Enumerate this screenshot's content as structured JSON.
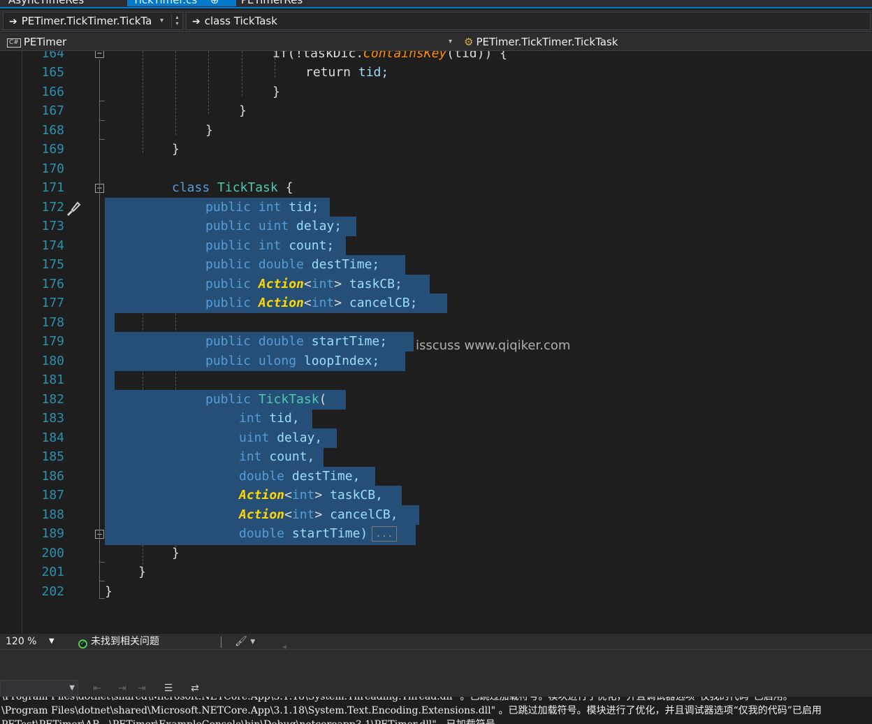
{
  "tabs": {
    "items": [
      "AsyncTimeRes",
      "TickTimer.cs",
      "PETimerRes"
    ],
    "active_pin": "⊕",
    "active_close": "✕"
  },
  "nav1": {
    "scope_combo": "PETimer.TickTimer.TickTa",
    "member_combo": "class TickTask",
    "arrow_icon": "➔"
  },
  "nav2": {
    "project": "PETimer",
    "type": "PETimer.TickTimer.TickTask"
  },
  "editor": {
    "line_numbers": [
      "164",
      "165",
      "166",
      "167",
      "168",
      "169",
      "170",
      "171",
      "172",
      "173",
      "174",
      "175",
      "176",
      "177",
      "178",
      "179",
      "180",
      "181",
      "182",
      "183",
      "184",
      "185",
      "186",
      "187",
      "188",
      "189",
      "200",
      "201",
      "202"
    ],
    "code": {
      "l164a": "if(!taskDic.",
      "l164b": "ContainsKey",
      "l164c": "(tid)) {",
      "l165_kw": "return",
      "l165_id": " tid;",
      "brace": "}",
      "l171_kw": "class ",
      "l171_ty": "TickTask",
      "l171_pl": " {",
      "kw_public": "public ",
      "kw_int": "int",
      "kw_uint": "uint",
      "kw_double": "double",
      "kw_ulong": "ulong",
      "type_action": "Action",
      "generic_int_open": "<",
      "generic_int": "int",
      "generic_int_close": ">",
      "f_tid": " tid;",
      "f_delay": " delay;",
      "f_count": " count;",
      "f_destTime": " destTime;",
      "f_taskCB": " taskCB;",
      "f_cancelCB": " cancelCB;",
      "f_startTime": " startTime;",
      "f_loopIndex": " loopIndex;",
      "ctor_name": "TickTask",
      "ctor_open": "(",
      "p_tid": " tid,",
      "p_delay": " delay,",
      "p_count": " count,",
      "p_destTime": " destTime,",
      "p_taskCB": " taskCB,",
      "p_cancelCB": " cancelCB,",
      "p_startTime": " startTime)",
      "collapsed_marker": "..."
    },
    "watermark": "isscuss www.qiqiker.com"
  },
  "status": {
    "zoom": "120 %",
    "issues": "未找到相关问题"
  },
  "output": {
    "line1": "\\Program Files\\dotnet\\shared\\Microsoft.NETCore.App\\3.1.18\\System.Threading.Thread.dll\" 。已跳过加载符号。模块进行了优化，并且调试器选项“仅我的代码”已启用。",
    "line2": "\\Program Files\\dotnet\\shared\\Microsoft.NETCore.App\\3.1.18\\System.Text.Encoding.Extensions.dll\" 。已跳过加载符号。模块进行了优化，并且调试器选项“仅我的代码”已启用",
    "line3": "PETest\\PETimer\\AR   \\PETimer\\ExampleConsole\\bin\\Debug\\netcoreapp3.1\\PETimer.dll\"。已加载符号。"
  }
}
